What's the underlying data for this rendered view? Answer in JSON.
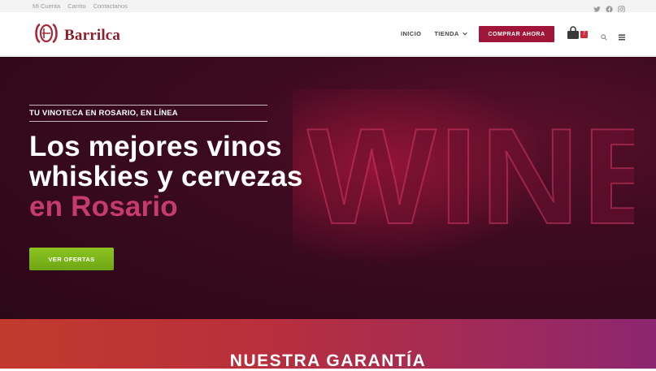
{
  "topbar": {
    "links": [
      "Mi Cuenta",
      "Carrito",
      "Contactanos"
    ],
    "social_icons": [
      "twitter-icon",
      "facebook-icon",
      "instagram-icon"
    ]
  },
  "header": {
    "logo_text": "Barrilca",
    "nav": {
      "inicio": "INICIO",
      "tienda": "TIENDA"
    },
    "cta": "COMPRAR AHORA",
    "cart_count": "7"
  },
  "hero": {
    "kicker": "TU VINOTECA EN ROSARIO, EN LÍNEA",
    "title_line1": "Los mejores vinos",
    "title_line2": "whiskies y cervezas",
    "title_line3": "en Rosario",
    "button": "VER OFERTAS",
    "sign_text": "WINE"
  },
  "garantia": {
    "title": "NUESTRA GARANTÍA"
  },
  "colors": {
    "brand": "#8e1e2b",
    "cta": "#a11638",
    "accent_green": "#7db51b",
    "hero_bg": "#3c0a1f",
    "highlight": "#c43b6c"
  }
}
